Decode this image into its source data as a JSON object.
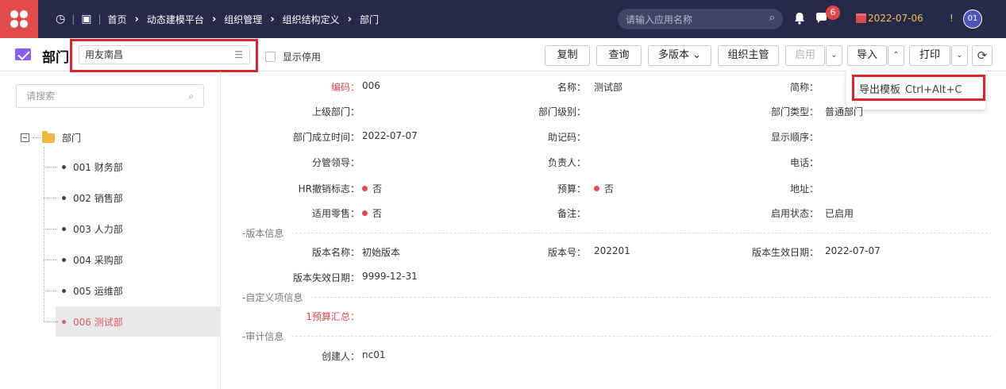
{
  "topbar": {
    "breadcrumbs": [
      "首页",
      "动态建模平台",
      "组织管理",
      "组织结构定义",
      "部门"
    ],
    "app_search_placeholder": "请输入应用名称",
    "notification_count": "6",
    "date": "2022-07-06",
    "alert": "!",
    "user": "01"
  },
  "toolbar": {
    "title": "部门",
    "org_value": "用友南昌",
    "show_disabled_label": "显示停用",
    "buttons": {
      "copy": "复制",
      "query": "查询",
      "multi_version": "多版本 ⌄",
      "org_leader": "组织主管",
      "enable": "启用",
      "import": "导入",
      "print": "打印"
    }
  },
  "dropdown": {
    "item_label": "导出模板",
    "shortcut": "Ctrl+Alt+C"
  },
  "tree": {
    "search_placeholder": "请搜索",
    "root": "部门",
    "items": [
      "001 财务部",
      "002 销售部",
      "003 人力部",
      "004 采购部",
      "005 运维部",
      "006 测试部"
    ],
    "selected_index": 5
  },
  "form": {
    "code_label": "编码：",
    "code_value": "006",
    "name_label": "名称：",
    "name_value": "测试部",
    "short_label": "简称：",
    "parent_label": "上级部门：",
    "level_label": "部门级别：",
    "type_label": "部门类型：",
    "type_value": "普通部门",
    "founded_label": "部门成立时间：",
    "founded_value": "2022-07-07",
    "mnemonic_label": "助记码：",
    "order_label": "显示顺序：",
    "leader_label": "分管领导：",
    "principal_label": "负责人：",
    "phone_label": "电话：",
    "hr_label": "HR撤销标志：",
    "hr_value": "否",
    "budget_label": "预算：",
    "budget_value": "否",
    "address_label": "地址：",
    "retail_label": "适用零售：",
    "retail_value": "否",
    "remark_label": "备注：",
    "status_label": "启用状态：",
    "status_value": "已启用",
    "version_section": "版本信息",
    "version_name_label": "版本名称：",
    "version_name_value": "初始版本",
    "version_no_label": "版本号：",
    "version_no_value": "202201",
    "version_eff_label": "版本生效日期：",
    "version_eff_value": "2022-07-07",
    "version_exp_label": "版本失效日期：",
    "version_exp_value": "9999-12-31",
    "custom_section": "自定义项信息",
    "budget_sum_label": "1预算汇总：",
    "audit_section": "审计信息",
    "creator_label": "创建人：",
    "creator_value": "nc01"
  }
}
